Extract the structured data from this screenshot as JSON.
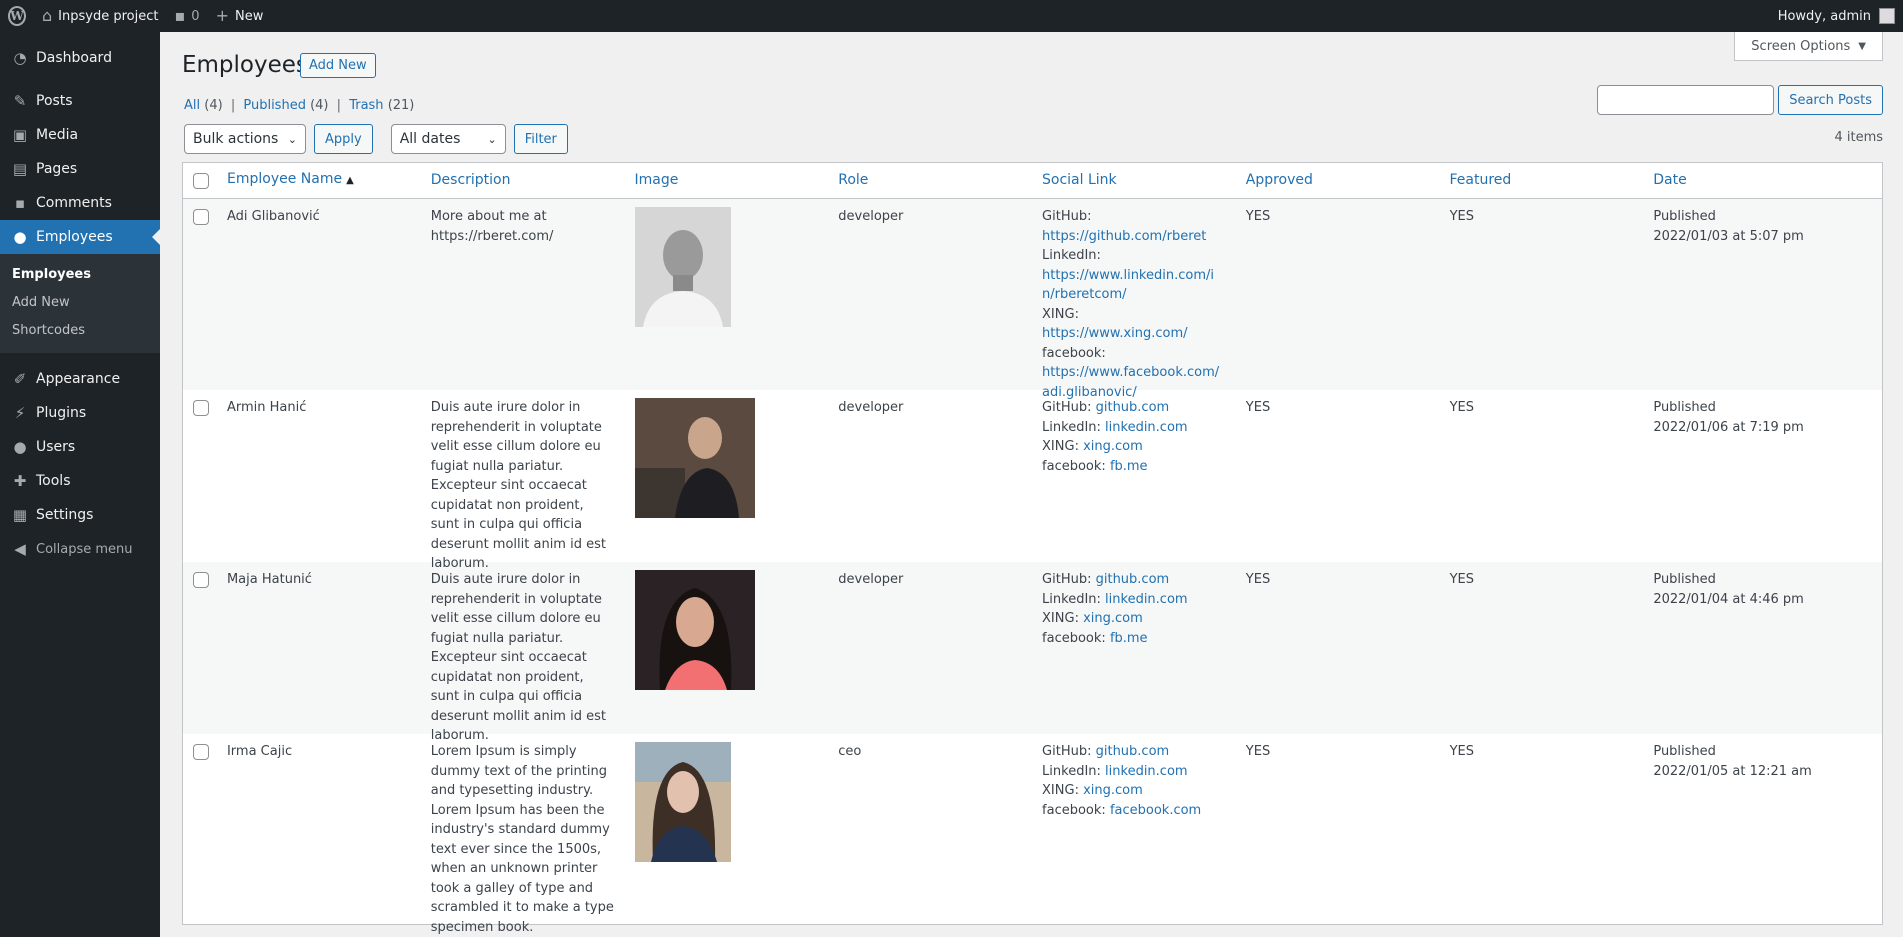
{
  "adminbar": {
    "site_name": "Inpsyde project",
    "comments_count": "0",
    "new_label": "New",
    "howdy": "Howdy, admin"
  },
  "sidebar": {
    "items": [
      {
        "label": "Dashboard",
        "icon": "dashboard-icon"
      },
      {
        "label": "Posts",
        "icon": "pin-icon"
      },
      {
        "label": "Media",
        "icon": "media-icon"
      },
      {
        "label": "Pages",
        "icon": "pages-icon"
      },
      {
        "label": "Comments",
        "icon": "comment-icon"
      },
      {
        "label": "Employees",
        "icon": "user-icon"
      },
      {
        "label": "Appearance",
        "icon": "brush-icon"
      },
      {
        "label": "Plugins",
        "icon": "plugin-icon"
      },
      {
        "label": "Users",
        "icon": "users-icon"
      },
      {
        "label": "Tools",
        "icon": "wrench-icon"
      },
      {
        "label": "Settings",
        "icon": "settings-icon"
      }
    ],
    "submenu": [
      "Employees",
      "Add New",
      "Shortcodes"
    ],
    "collapse": "Collapse menu"
  },
  "header": {
    "screen_options": "Screen Options",
    "title": "Employees",
    "add_new": "Add New"
  },
  "filters": {
    "all": "All",
    "all_count": "(4)",
    "published": "Published",
    "published_count": "(4)",
    "trash": "Trash",
    "trash_count": "(21)",
    "sep": "|"
  },
  "search": {
    "button": "Search Posts"
  },
  "tablenav": {
    "bulk_actions": "Bulk actions",
    "apply": "Apply",
    "all_dates": "All dates",
    "filter": "Filter",
    "items": "4 items"
  },
  "table": {
    "columns": [
      "Employee Name",
      "Description",
      "Image",
      "Role",
      "Social Link",
      "Approved",
      "Featured",
      "Date"
    ],
    "rows": [
      {
        "name": "Adi Glibanović",
        "description": "More about me at https://rberet.com/",
        "role": "developer",
        "social": [
          {
            "label": "GitHub:",
            "value": "https://github.com/rberet",
            "block": true
          },
          {
            "label": "LinkedIn:",
            "value": "https://www.linkedin.com/in/rberetcom/",
            "block": true
          },
          {
            "label": "XING:",
            "value": "https://www.xing.com/",
            "block": false
          },
          {
            "label": "facebook:",
            "value": "https://www.facebook.com/adi.glibanovic/",
            "block": true
          }
        ],
        "approved": "YES",
        "featured": "YES",
        "status": "Published",
        "date": "2022/01/03 at 5:07 pm"
      },
      {
        "name": "Armin Hanić",
        "description": "Duis aute irure dolor in reprehenderit in voluptate velit esse cillum dolore eu fugiat nulla pariatur. Excepteur sint occaecat cupidatat non proident, sunt in culpa qui officia deserunt mollit anim id est laborum.",
        "role": "developer",
        "social": [
          {
            "label": "GitHub:",
            "value": "github.com",
            "block": false
          },
          {
            "label": "LinkedIn:",
            "value": "linkedin.com",
            "block": false
          },
          {
            "label": "XING:",
            "value": "xing.com",
            "block": false
          },
          {
            "label": "facebook:",
            "value": "fb.me",
            "block": false
          }
        ],
        "approved": "YES",
        "featured": "YES",
        "status": "Published",
        "date": "2022/01/06 at 7:19 pm"
      },
      {
        "name": "Maja Hatunić",
        "description": "Duis aute irure dolor in reprehenderit in voluptate velit esse cillum dolore eu fugiat nulla pariatur. Excepteur sint occaecat cupidatat non proident, sunt in culpa qui officia deserunt mollit anim id est laborum.",
        "role": "developer",
        "social": [
          {
            "label": "GitHub:",
            "value": "github.com",
            "block": false
          },
          {
            "label": "LinkedIn:",
            "value": "linkedin.com",
            "block": false
          },
          {
            "label": "XING:",
            "value": "xing.com",
            "block": false
          },
          {
            "label": "facebook:",
            "value": "fb.me",
            "block": false
          }
        ],
        "approved": "YES",
        "featured": "YES",
        "status": "Published",
        "date": "2022/01/04 at 4:46 pm"
      },
      {
        "name": "Irma Cajic",
        "description": "Lorem Ipsum is simply dummy text of the printing and typesetting industry. Lorem Ipsum has been the industry's standard dummy text ever since the 1500s, when an unknown printer took a galley of type and scrambled it to make a type specimen book.",
        "role": "ceo",
        "social": [
          {
            "label": "GitHub:",
            "value": "github.com",
            "block": false
          },
          {
            "label": "LinkedIn:",
            "value": "linkedin.com",
            "block": false
          },
          {
            "label": "XING:",
            "value": "xing.com",
            "block": false
          },
          {
            "label": "facebook:",
            "value": "facebook.com",
            "block": false
          }
        ],
        "approved": "YES",
        "featured": "YES",
        "status": "Published",
        "date": "2022/01/05 at 12:21 am"
      }
    ]
  },
  "colors": {
    "admin_bg": "#1d2327",
    "accent": "#2271b1",
    "page_bg": "#f0f0f1"
  }
}
